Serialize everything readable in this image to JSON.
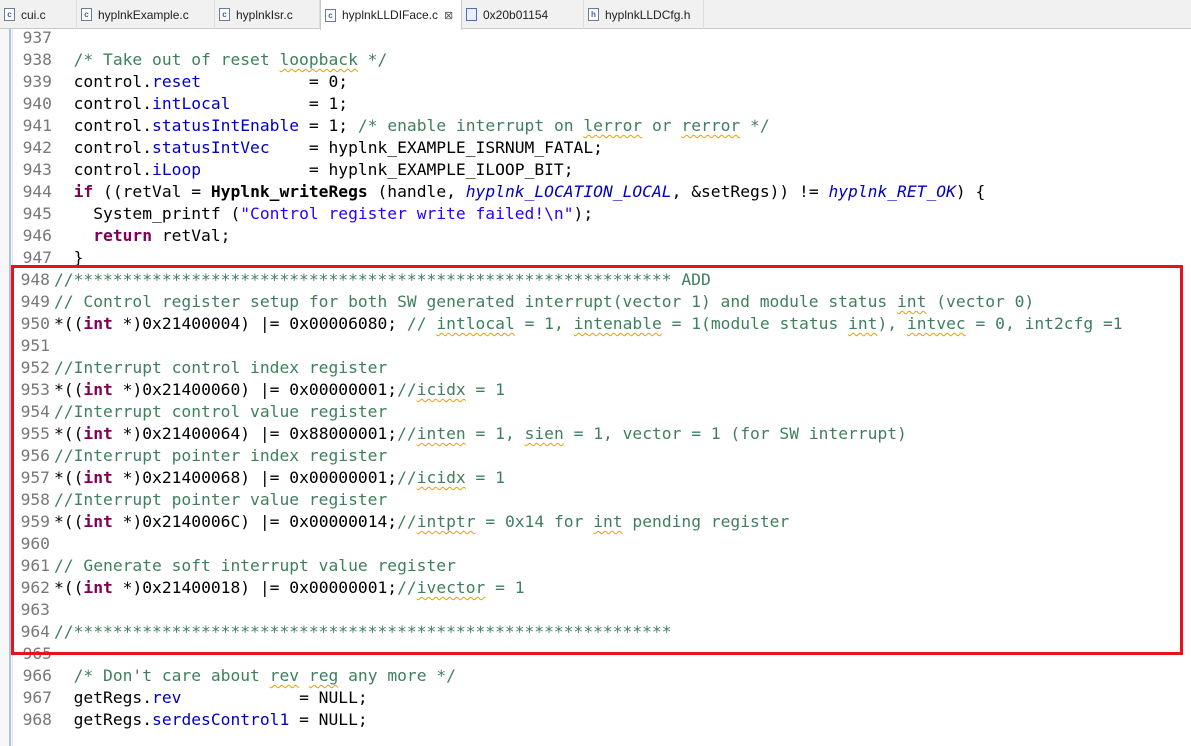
{
  "tabs": [
    {
      "label": "cui.c",
      "icon": "c-file-icon"
    },
    {
      "label": "hyplnkExample.c",
      "icon": "c-file-icon"
    },
    {
      "label": "hyplnkIsr.c",
      "icon": "c-file-icon"
    },
    {
      "label": "hyplnkLLDIFace.c",
      "icon": "c-file-icon",
      "active": true,
      "close": "⊠"
    },
    {
      "label": "0x20b01154",
      "icon": "memory-view-icon"
    },
    {
      "label": "hyplnkLLDCfg.h",
      "icon": "h-file-icon"
    }
  ],
  "icon_letters": {
    "c": "c",
    "h": "h",
    "mem": ""
  },
  "colors": {
    "highlight_box": "#e8121d",
    "comment": "#3f7f5f",
    "keyword": "#7f0055",
    "field": "#0000c0",
    "string": "#2a00ff"
  },
  "lines": [
    {
      "num": "937",
      "tokens": [
        {
          "t": "  "
        }
      ]
    },
    {
      "num": "938",
      "tokens": [
        {
          "t": "  /* Take out of reset ",
          "c": "com"
        },
        {
          "t": "loopback",
          "c": "com sq"
        },
        {
          "t": " */",
          "c": "com"
        }
      ]
    },
    {
      "num": "939",
      "tokens": [
        {
          "t": "  control."
        },
        {
          "t": "reset",
          "c": "fld"
        },
        {
          "t": "           = 0;"
        }
      ]
    },
    {
      "num": "940",
      "tokens": [
        {
          "t": "  control."
        },
        {
          "t": "intLocal",
          "c": "fld"
        },
        {
          "t": "        = 1;"
        }
      ]
    },
    {
      "num": "941",
      "tokens": [
        {
          "t": "  control."
        },
        {
          "t": "statusIntEnable",
          "c": "fld"
        },
        {
          "t": " = 1; "
        },
        {
          "t": "/* enable interrupt on ",
          "c": "com"
        },
        {
          "t": "lerror",
          "c": "com sq"
        },
        {
          "t": " or ",
          "c": "com"
        },
        {
          "t": "rerror",
          "c": "com sq"
        },
        {
          "t": " */",
          "c": "com"
        }
      ]
    },
    {
      "num": "942",
      "tokens": [
        {
          "t": "  control."
        },
        {
          "t": "statusIntVec",
          "c": "fld"
        },
        {
          "t": "    = hyplnk_EXAMPLE_ISRNUM_FATAL;"
        }
      ]
    },
    {
      "num": "943",
      "tokens": [
        {
          "t": "  control."
        },
        {
          "t": "iLoop",
          "c": "fld"
        },
        {
          "t": "           = hyplnk_EXAMPLE_ILOOP_BIT;"
        }
      ]
    },
    {
      "num": "944",
      "tokens": [
        {
          "t": "  "
        },
        {
          "t": "if",
          "c": "kw"
        },
        {
          "t": " ((retVal = "
        },
        {
          "t": "Hyplnk_writeRegs",
          "c": "fn"
        },
        {
          "t": " (handle, "
        },
        {
          "t": "hyplnk_LOCATION_LOCAL",
          "c": "cst"
        },
        {
          "t": ", &setRegs)) != "
        },
        {
          "t": "hyplnk_RET_OK",
          "c": "cst"
        },
        {
          "t": ") {"
        }
      ]
    },
    {
      "num": "945",
      "tokens": [
        {
          "t": "    System_printf ("
        },
        {
          "t": "\"Control register write failed!\\n\"",
          "c": "str"
        },
        {
          "t": ");"
        }
      ]
    },
    {
      "num": "946",
      "tokens": [
        {
          "t": "    "
        },
        {
          "t": "return",
          "c": "kw"
        },
        {
          "t": " retVal;"
        }
      ]
    },
    {
      "num": "947",
      "tokens": [
        {
          "t": "  }"
        }
      ]
    },
    {
      "num": "948",
      "w": true,
      "tokens": [
        {
          "t": "//************************************************************* ADD",
          "c": "com"
        }
      ]
    },
    {
      "num": "949",
      "w": true,
      "tokens": [
        {
          "t": "// Control register setup for both SW generated interrupt(vector 1) and module status ",
          "c": "com"
        },
        {
          "t": "int",
          "c": "com sq"
        },
        {
          "t": " (vector 0)",
          "c": "com"
        }
      ]
    },
    {
      "num": "950",
      "w": true,
      "tokens": [
        {
          "t": "*(("
        },
        {
          "t": "int",
          "c": "kw"
        },
        {
          "t": " *)0x21400004) |= 0x00006080; "
        },
        {
          "t": "// ",
          "c": "com"
        },
        {
          "t": "intlocal",
          "c": "com sq"
        },
        {
          "t": " = 1, ",
          "c": "com"
        },
        {
          "t": "intenable",
          "c": "com sq"
        },
        {
          "t": " = 1(module status ",
          "c": "com"
        },
        {
          "t": "int",
          "c": "com sq"
        },
        {
          "t": "), ",
          "c": "com"
        },
        {
          "t": "intvec",
          "c": "com sq"
        },
        {
          "t": " = 0, int2cfg =1",
          "c": "com"
        }
      ]
    },
    {
      "num": "951",
      "w": true,
      "tokens": [
        {
          "t": ""
        }
      ]
    },
    {
      "num": "952",
      "w": true,
      "tokens": [
        {
          "t": "//Interrupt control index register",
          "c": "com"
        }
      ]
    },
    {
      "num": "953",
      "w": true,
      "tokens": [
        {
          "t": "*(("
        },
        {
          "t": "int",
          "c": "kw"
        },
        {
          "t": " *)0x21400060) |= 0x00000001;"
        },
        {
          "t": "//",
          "c": "com"
        },
        {
          "t": "icidx",
          "c": "com sq"
        },
        {
          "t": " = 1",
          "c": "com"
        }
      ]
    },
    {
      "num": "954",
      "w": true,
      "tokens": [
        {
          "t": "//Interrupt control value register",
          "c": "com"
        }
      ]
    },
    {
      "num": "955",
      "w": true,
      "tokens": [
        {
          "t": "*(("
        },
        {
          "t": "int",
          "c": "kw"
        },
        {
          "t": " *)0x21400064) |= 0x88000001;"
        },
        {
          "t": "//",
          "c": "com"
        },
        {
          "t": "inten",
          "c": "com sq"
        },
        {
          "t": " = 1, ",
          "c": "com"
        },
        {
          "t": "sien",
          "c": "com sq"
        },
        {
          "t": " = 1, vector = 1 (for SW interrupt)",
          "c": "com"
        }
      ]
    },
    {
      "num": "956",
      "w": true,
      "tokens": [
        {
          "t": "//Interrupt pointer index register",
          "c": "com"
        }
      ]
    },
    {
      "num": "957",
      "w": true,
      "tokens": [
        {
          "t": "*(("
        },
        {
          "t": "int",
          "c": "kw"
        },
        {
          "t": " *)0x21400068) |= 0x00000001;"
        },
        {
          "t": "//",
          "c": "com"
        },
        {
          "t": "icidx",
          "c": "com sq"
        },
        {
          "t": " = 1",
          "c": "com"
        }
      ]
    },
    {
      "num": "958",
      "w": true,
      "tokens": [
        {
          "t": "//Interrupt pointer value register",
          "c": "com"
        }
      ]
    },
    {
      "num": "959",
      "w": true,
      "tokens": [
        {
          "t": "*(("
        },
        {
          "t": "int",
          "c": "kw"
        },
        {
          "t": " *)0x2140006C) |= 0x00000014;"
        },
        {
          "t": "//",
          "c": "com"
        },
        {
          "t": "intptr",
          "c": "com sq"
        },
        {
          "t": " = 0x14 for ",
          "c": "com"
        },
        {
          "t": "int",
          "c": "com sq"
        },
        {
          "t": " pending register",
          "c": "com"
        }
      ]
    },
    {
      "num": "960",
      "w": true,
      "tokens": [
        {
          "t": ""
        }
      ]
    },
    {
      "num": "961",
      "w": true,
      "tokens": [
        {
          "t": "// Generate soft interrupt value register",
          "c": "com"
        }
      ]
    },
    {
      "num": "962",
      "w": true,
      "tokens": [
        {
          "t": "*(("
        },
        {
          "t": "int",
          "c": "kw"
        },
        {
          "t": " *)0x21400018) |= 0x00000001;"
        },
        {
          "t": "//",
          "c": "com"
        },
        {
          "t": "ivector",
          "c": "com sq"
        },
        {
          "t": " = 1",
          "c": "com"
        }
      ]
    },
    {
      "num": "963",
      "w": true,
      "tokens": [
        {
          "t": ""
        }
      ]
    },
    {
      "num": "964",
      "w": true,
      "tokens": [
        {
          "t": "//*************************************************************",
          "c": "com"
        }
      ]
    },
    {
      "num": "965",
      "tokens": [
        {
          "t": ""
        }
      ]
    },
    {
      "num": "966",
      "tokens": [
        {
          "t": "  /* Don't care about ",
          "c": "com"
        },
        {
          "t": "rev",
          "c": "com sq"
        },
        {
          "t": " ",
          "c": "com"
        },
        {
          "t": "reg",
          "c": "com sq"
        },
        {
          "t": " any more */",
          "c": "com"
        }
      ]
    },
    {
      "num": "967",
      "tokens": [
        {
          "t": "  getRegs."
        },
        {
          "t": "rev",
          "c": "fld"
        },
        {
          "t": "            = NULL;"
        }
      ]
    },
    {
      "num": "968",
      "tokens": [
        {
          "t": "  getRegs."
        },
        {
          "t": "serdesControl1",
          "c": "fld"
        },
        {
          "t": " = NULL;"
        }
      ]
    }
  ]
}
